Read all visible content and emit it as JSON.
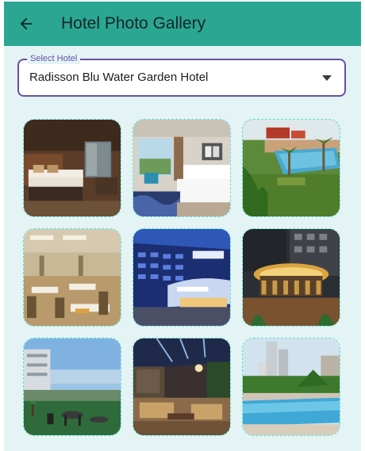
{
  "appbar": {
    "title": "Hotel Photo Gallery",
    "back_icon": "arrow-back-icon"
  },
  "hotel_select": {
    "label": "Select Hotel",
    "selected": "Radisson Blu Water Garden Hotel",
    "dropdown_icon": "arrow-drop-down-icon"
  },
  "gallery": {
    "photos": [
      "room-bed-window",
      "room-bed-lounge",
      "pool-garden",
      "restaurant-dining",
      "hotel-exterior",
      "bar-lounge",
      "rooftop-terrace",
      "lobby-lounge",
      "pool-skyline"
    ]
  },
  "colors": {
    "appbar": "#2aa692",
    "background": "#e4f3f4",
    "accent": "#6550a4",
    "tile_border": "#5fe0d3"
  }
}
